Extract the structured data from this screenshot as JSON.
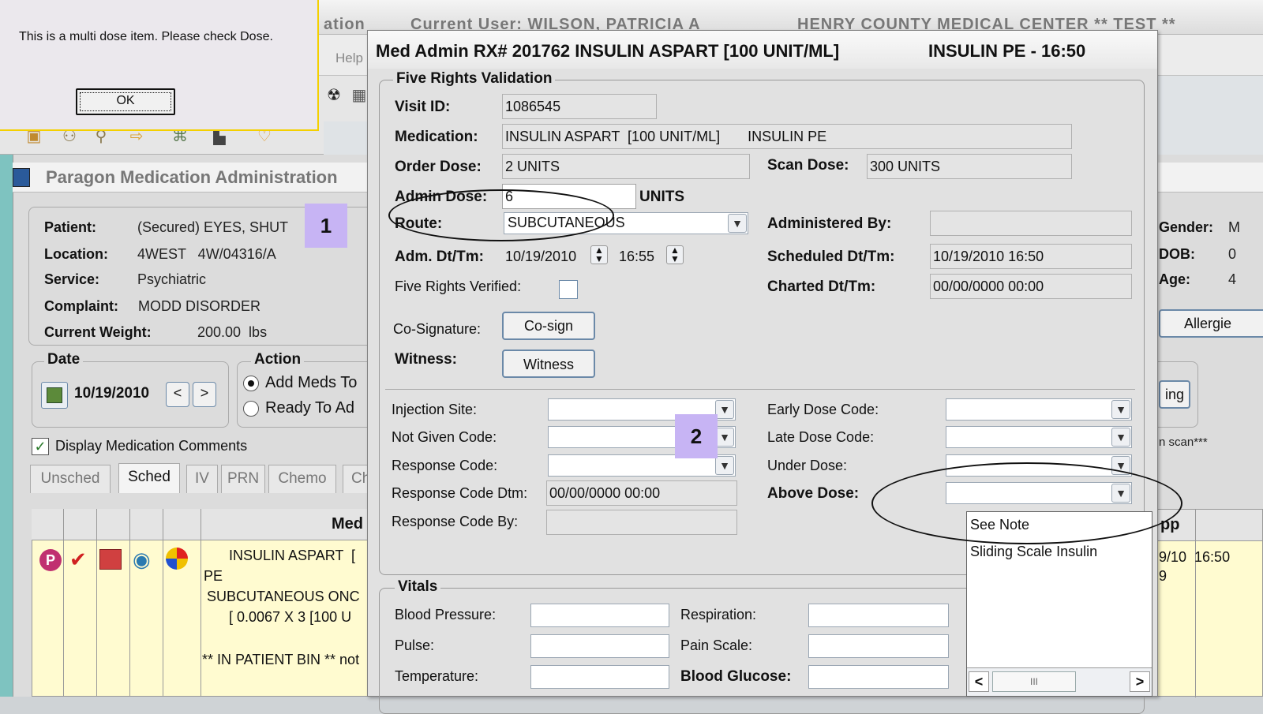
{
  "alert": {
    "message": "This is a multi dose item. Please check Dose.",
    "ok_label": "OK"
  },
  "background": {
    "title_segment1": "ation",
    "title_segment2": "Current User:   WILSON, PATRICIA A",
    "title_segment3": "HENRY COUNTY MEDICAL CENTER ** TEST **",
    "menu_help": "Help",
    "inner_window_title": "Paragon Medication Administration",
    "patient": {
      "patient_label": "Patient:",
      "patient_value": "(Secured) EYES, SHUT",
      "location_label": "Location:",
      "location_value": "4WEST   4W/04316/A",
      "service_label": "Service:",
      "service_value": "Psychiatric",
      "complaint_label": "Complaint:",
      "complaint_value": "MODD DISORDER",
      "weight_label": "Current Weight:",
      "weight_value": "200.00  lbs",
      "gender_label": "Gender:",
      "gender_value": "M",
      "dob_label": "DOB:",
      "dob_value": "0",
      "age_label": "Age:",
      "age_value": "4"
    },
    "allergies_button": "Allergie",
    "ing_button": "ing",
    "scan_note": "n scan***",
    "date_group": {
      "title": "Date",
      "date_value": "10/19/2010",
      "prev": "<",
      "next": ">"
    },
    "action_group": {
      "title": "Action",
      "option1": "Add Meds To",
      "option2": "Ready To Ad"
    },
    "display_comments": "Display Medication Comments",
    "tabs": [
      "Unsched",
      "Sched",
      "IV",
      "PRN",
      "Chemo",
      "Ch"
    ],
    "grid_header": "Med",
    "grid_header_right": "pp",
    "grid_rows": [
      "INSULIN ASPART  [",
      "PE",
      "SUBCUTANEOUS ONC",
      "[ 0.0067 X 3 [100 U",
      "** IN PATIENT BIN ** not"
    ],
    "grid_right_value": "9/10  16:50",
    "grid_right_value2": "9"
  },
  "dialog": {
    "title_left": "Med Admin RX# 201762 INSULIN ASPART  [100 UNIT/ML]",
    "title_right": "INSULIN PE - 16:50",
    "five_rights_title": "Five Rights Validation",
    "visit_id_label": "Visit ID:",
    "visit_id_value": "1086545",
    "medication_label": "Medication:",
    "medication_value": "INSULIN ASPART  [100 UNIT/ML]       INSULIN PE",
    "order_dose_label": "Order Dose:",
    "order_dose_value": "2 UNITS",
    "scan_dose_label": "Scan Dose:",
    "scan_dose_value": "300 UNITS",
    "admin_dose_label": "Admin Dose:",
    "admin_dose_value": "6",
    "admin_dose_unit": "UNITS",
    "route_label": "Route:",
    "route_value": "SUBCUTANEOUS",
    "administered_by_label": "Administered By:",
    "adm_dt_label": "Adm. Dt/Tm:",
    "adm_date": "10/19/2010",
    "adm_time": "16:55",
    "scheduled_label": "Scheduled Dt/Tm:",
    "scheduled_value": "10/19/2010 16:50",
    "five_rights_verified_label": "Five Rights Verified:",
    "charted_label": "Charted Dt/Tm:",
    "charted_value": "00/00/0000 00:00",
    "cosig_label": "Co-Signature:",
    "cosign_button": "Co-sign",
    "witness_label": "Witness:",
    "witness_button": "Witness",
    "injection_site_label": "Injection Site:",
    "not_given_label": "Not Given Code:",
    "response_code_label": "Response Code:",
    "response_dtm_label": "Response Code Dtm:",
    "response_dtm_value": "00/00/0000 00:00",
    "response_by_label": "Response Code By:",
    "early_dose_label": "Early Dose Code:",
    "late_dose_label": "Late Dose Code:",
    "under_dose_label": "Under Dose:",
    "above_dose_label": "Above Dose:",
    "above_dose_options": [
      "See Note",
      "Sliding Scale Insulin"
    ],
    "vitals_title": "Vitals",
    "bp_label": "Blood Pressure:",
    "respiration_label": "Respiration:",
    "pulse_label": "Pulse:",
    "pain_label": "Pain Scale:",
    "temperature_label": "Temperature:",
    "glucose_label": "Blood Glucose:"
  },
  "markers": {
    "marker1": "1",
    "marker2": "2"
  },
  "scroll": {
    "left": "<",
    "right": ">",
    "thumb": "III"
  }
}
